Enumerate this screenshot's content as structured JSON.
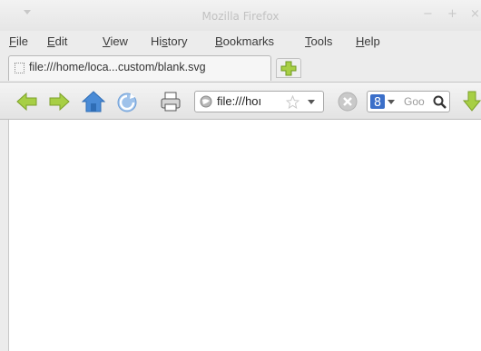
{
  "window": {
    "title": "Mozilla Firefox",
    "controls": {
      "minimize": "−",
      "maximize": "+",
      "close": "×"
    }
  },
  "menubar": {
    "items": [
      {
        "label_acc": "F",
        "label_rest": "ile"
      },
      {
        "label_acc": "E",
        "label_rest": "dit"
      },
      {
        "label_acc": "V",
        "label_rest": "iew"
      },
      {
        "label_pre": "Hi",
        "label_acc": "s",
        "label_rest": "tory"
      },
      {
        "label_acc": "B",
        "label_rest": "ookmarks"
      },
      {
        "label_acc": "T",
        "label_rest": "ools"
      },
      {
        "label_acc": "H",
        "label_rest": "elp"
      }
    ]
  },
  "tabs": [
    {
      "label": "file:///home/loca...custom/blank.svg",
      "favicon": "blank-page-icon"
    }
  ],
  "newtab": {
    "icon": "plus-icon"
  },
  "toolbar": {
    "icons": [
      "back-arrow-icon",
      "forward-arrow-icon",
      "home-icon",
      "reload-icon",
      "print-icon",
      "stop-icon",
      "download-arrow-icon"
    ]
  },
  "urlbar": {
    "value": "file:///home/localhost/custom/blank.svg",
    "visible_text": "file:///hoı",
    "icon": "globe-icon",
    "bookmark_icon": "star-icon"
  },
  "search": {
    "engine": "google-icon",
    "engine_glyph": "8",
    "placeholder": "Goo",
    "icon": "magnifier-icon"
  },
  "colors": {
    "green_arrow": "#9ccb3a",
    "home_blue": "#4a8bd6",
    "reload_blue": "#5a95d8",
    "google_blue": "#3b6fc9",
    "title_gray": "#c2c2c2"
  }
}
